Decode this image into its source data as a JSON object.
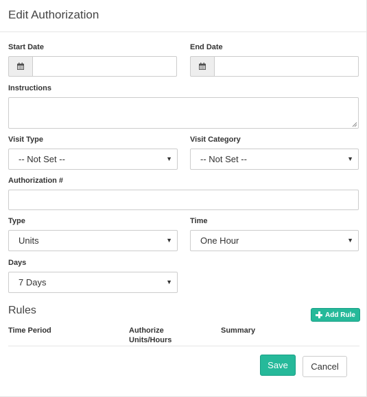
{
  "header": {
    "title": "Edit Authorization"
  },
  "form": {
    "start_date": {
      "label": "Start Date",
      "value": ""
    },
    "end_date": {
      "label": "End Date",
      "value": ""
    },
    "instructions": {
      "label": "Instructions",
      "value": ""
    },
    "visit_type": {
      "label": "Visit Type",
      "selected": "-- Not Set --"
    },
    "visit_category": {
      "label": "Visit Category",
      "selected": "-- Not Set --"
    },
    "authorization_number": {
      "label": "Authorization #",
      "value": ""
    },
    "type": {
      "label": "Type",
      "selected": "Units"
    },
    "time": {
      "label": "Time",
      "selected": "One Hour"
    },
    "days": {
      "label": "Days",
      "selected": "7 Days"
    }
  },
  "rules": {
    "title": "Rules",
    "add_label": "Add Rule",
    "columns": [
      "Time Period",
      "Authorize Units/Hours",
      "Summary"
    ],
    "rows": []
  },
  "footer": {
    "save_label": "Save",
    "cancel_label": "Cancel"
  },
  "icons": {
    "calendar": "calendar-icon",
    "caret": "caret-down-icon",
    "plus": "plus-icon",
    "resize": "resize-grip-icon"
  },
  "colors": {
    "accent": "#26b99a",
    "border": "#cccccc",
    "addon_bg": "#eeeeee"
  }
}
